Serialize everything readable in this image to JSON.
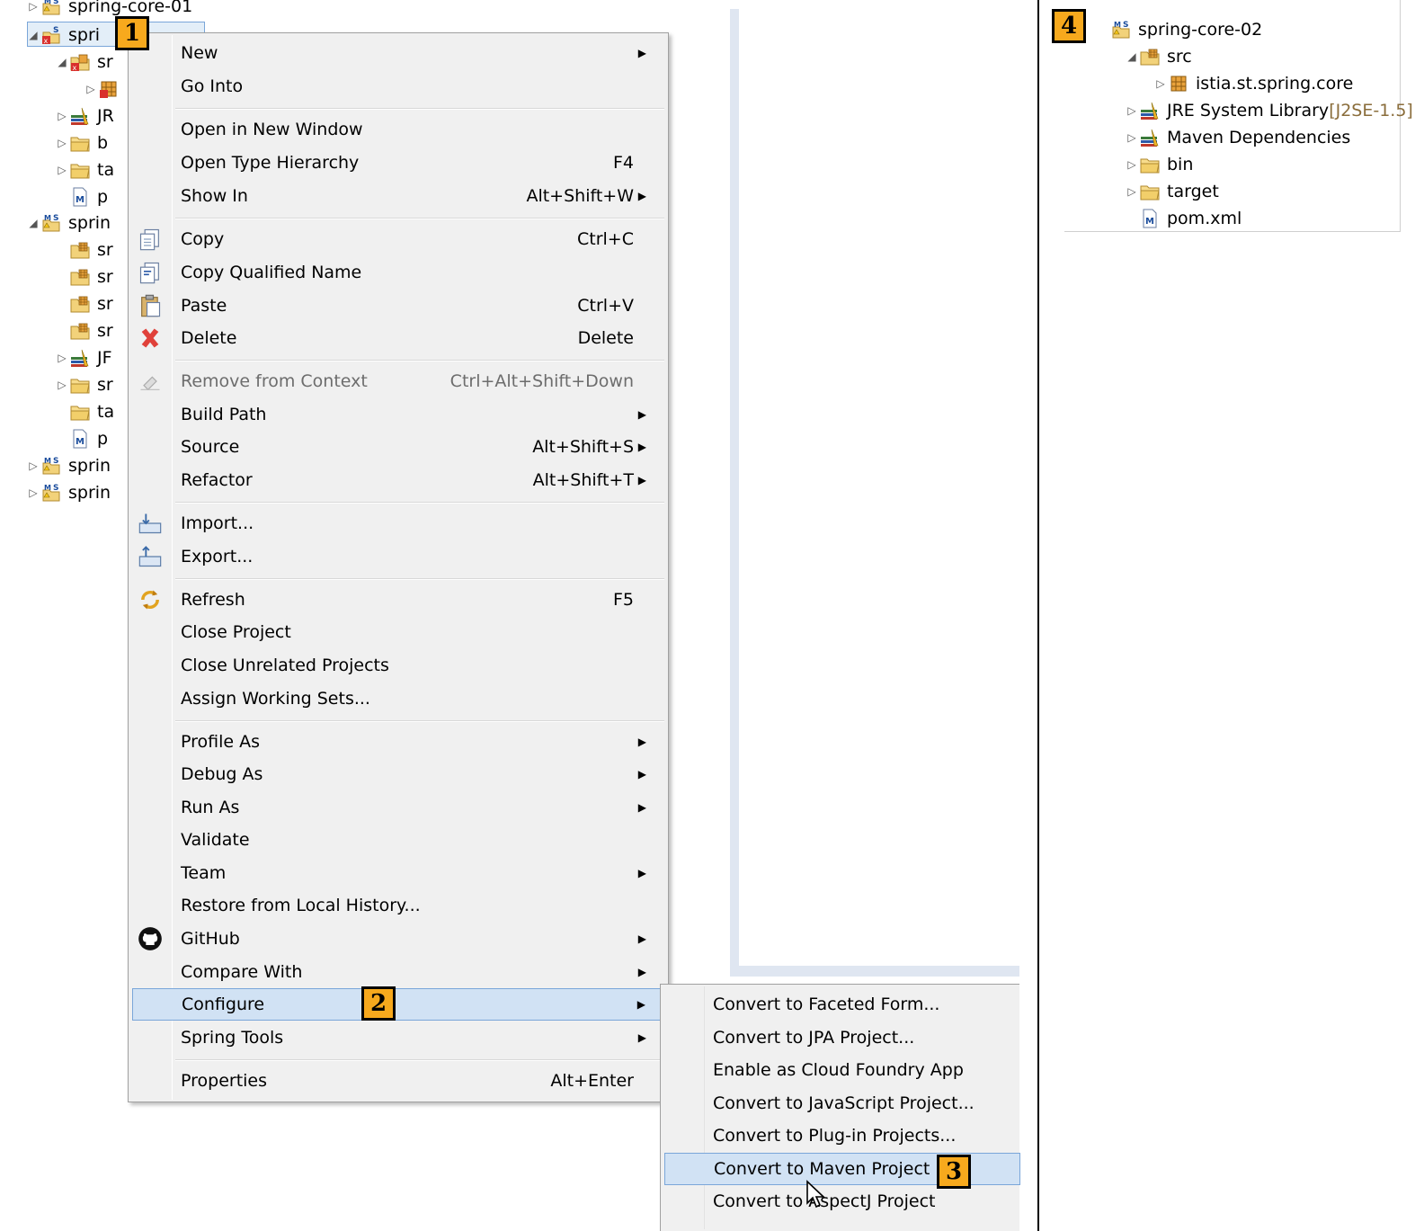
{
  "explorer": {
    "rows": [
      {
        "label": "spring-core-01",
        "indent": 0,
        "twisty": "▷",
        "icon": "maven-project-icon"
      },
      {
        "label": "spri",
        "indent": 0,
        "twisty": "◢",
        "icon": "project-error-icon"
      },
      {
        "label": "sr",
        "indent": 1,
        "twisty": "◢",
        "icon": "source-folder-error-icon"
      },
      {
        "label": "",
        "indent": 2,
        "twisty": "▷",
        "icon": "package-error-icon"
      },
      {
        "label": "JR",
        "indent": 1,
        "twisty": "▷",
        "icon": "library-icon"
      },
      {
        "label": "b",
        "indent": 1,
        "twisty": "▷",
        "icon": "folder-icon"
      },
      {
        "label": "ta",
        "indent": 1,
        "twisty": "▷",
        "icon": "folder-icon"
      },
      {
        "label": "p",
        "indent": 1,
        "twisty": "",
        "icon": "pom-file-icon"
      },
      {
        "label": "sprin",
        "indent": 0,
        "twisty": "◢",
        "icon": "maven-project-icon"
      },
      {
        "label": "sr",
        "indent": 1,
        "twisty": "",
        "icon": "source-folder-icon"
      },
      {
        "label": "sr",
        "indent": 1,
        "twisty": "",
        "icon": "source-folder-icon"
      },
      {
        "label": "sr",
        "indent": 1,
        "twisty": "",
        "icon": "source-folder-icon"
      },
      {
        "label": "sr",
        "indent": 1,
        "twisty": "",
        "icon": "source-folder-icon"
      },
      {
        "label": "JF",
        "indent": 1,
        "twisty": "▷",
        "icon": "library-icon"
      },
      {
        "label": "sr",
        "indent": 1,
        "twisty": "▷",
        "icon": "folder-icon"
      },
      {
        "label": "ta",
        "indent": 1,
        "twisty": "",
        "icon": "folder-icon"
      },
      {
        "label": "p",
        "indent": 1,
        "twisty": "",
        "icon": "pom-file-icon"
      },
      {
        "label": "sprin",
        "indent": 0,
        "twisty": "▷",
        "icon": "maven-project-icon"
      },
      {
        "label": "sprin",
        "indent": 0,
        "twisty": "▷",
        "icon": "maven-project-icon"
      }
    ]
  },
  "context_menu": {
    "items": [
      {
        "label": "New",
        "key": "",
        "arrow": true,
        "icon": ""
      },
      {
        "label": "Go Into",
        "key": "",
        "arrow": false,
        "icon": ""
      },
      {
        "label": "Open in New Window",
        "key": "",
        "arrow": false,
        "icon": ""
      },
      {
        "label": "Open Type Hierarchy",
        "key": "F4",
        "arrow": false,
        "icon": ""
      },
      {
        "label": "Show In",
        "key": "Alt+Shift+W",
        "arrow": true,
        "icon": ""
      },
      {
        "label": "Copy",
        "key": "Ctrl+C",
        "arrow": false,
        "icon": "copy-icon"
      },
      {
        "label": "Copy Qualified Name",
        "key": "",
        "arrow": false,
        "icon": "copy-qualified-icon"
      },
      {
        "label": "Paste",
        "key": "Ctrl+V",
        "arrow": false,
        "icon": "paste-icon"
      },
      {
        "label": "Delete",
        "key": "Delete",
        "arrow": false,
        "icon": "delete-icon"
      },
      {
        "label": "Remove from Context",
        "key": "Ctrl+Alt+Shift+Down",
        "arrow": false,
        "icon": "remove-context-icon",
        "disabled": true
      },
      {
        "label": "Build Path",
        "key": "",
        "arrow": true,
        "icon": ""
      },
      {
        "label": "Source",
        "key": "Alt+Shift+S",
        "arrow": true,
        "icon": ""
      },
      {
        "label": "Refactor",
        "key": "Alt+Shift+T",
        "arrow": true,
        "icon": ""
      },
      {
        "label": "Import...",
        "key": "",
        "arrow": false,
        "icon": "import-icon"
      },
      {
        "label": "Export...",
        "key": "",
        "arrow": false,
        "icon": "export-icon"
      },
      {
        "label": "Refresh",
        "key": "F5",
        "arrow": false,
        "icon": "refresh-icon"
      },
      {
        "label": "Close Project",
        "key": "",
        "arrow": false,
        "icon": ""
      },
      {
        "label": "Close Unrelated Projects",
        "key": "",
        "arrow": false,
        "icon": ""
      },
      {
        "label": "Assign Working Sets...",
        "key": "",
        "arrow": false,
        "icon": ""
      },
      {
        "label": "Profile As",
        "key": "",
        "arrow": true,
        "icon": ""
      },
      {
        "label": "Debug As",
        "key": "",
        "arrow": true,
        "icon": ""
      },
      {
        "label": "Run As",
        "key": "",
        "arrow": true,
        "icon": ""
      },
      {
        "label": "Validate",
        "key": "",
        "arrow": false,
        "icon": ""
      },
      {
        "label": "Team",
        "key": "",
        "arrow": true,
        "icon": ""
      },
      {
        "label": "Restore from Local History...",
        "key": "",
        "arrow": false,
        "icon": ""
      },
      {
        "label": "GitHub",
        "key": "",
        "arrow": true,
        "icon": "github-icon"
      },
      {
        "label": "Compare With",
        "key": "",
        "arrow": true,
        "icon": ""
      },
      {
        "label": "Configure",
        "key": "",
        "arrow": true,
        "icon": "",
        "highlighted": true
      },
      {
        "label": "Spring Tools",
        "key": "",
        "arrow": true,
        "icon": ""
      },
      {
        "label": "Properties",
        "key": "Alt+Enter",
        "arrow": false,
        "icon": ""
      }
    ]
  },
  "configure_submenu": {
    "items": [
      {
        "label": "Convert to Faceted Form..."
      },
      {
        "label": "Convert to JPA Project..."
      },
      {
        "label": "Enable as Cloud Foundry App"
      },
      {
        "label": "Convert to JavaScript Project..."
      },
      {
        "label": "Convert to Plug-in Projects..."
      },
      {
        "label": "Convert to Maven Project",
        "highlighted": true
      },
      {
        "label": "Convert to AspectJ Project"
      }
    ]
  },
  "result_tree": {
    "rows": [
      {
        "label": "spring-core-02",
        "suffix": "",
        "indent": 0,
        "twisty": "",
        "icon": "maven-project-icon"
      },
      {
        "label": "src",
        "suffix": "",
        "indent": 1,
        "twisty": "◢",
        "icon": "source-folder-icon"
      },
      {
        "label": "istia.st.spring.core",
        "suffix": "",
        "indent": 2,
        "twisty": "▷",
        "icon": "package-icon"
      },
      {
        "label": "JRE System Library ",
        "suffix": "[J2SE-1.5]",
        "indent": 1,
        "twisty": "▷",
        "icon": "library-icon"
      },
      {
        "label": "Maven Dependencies",
        "suffix": "",
        "indent": 1,
        "twisty": "▷",
        "icon": "library-icon"
      },
      {
        "label": "bin",
        "suffix": "",
        "indent": 1,
        "twisty": "▷",
        "icon": "folder-icon"
      },
      {
        "label": "target",
        "suffix": "",
        "indent": 1,
        "twisty": "▷",
        "icon": "folder-icon"
      },
      {
        "label": "pom.xml",
        "suffix": "",
        "indent": 1,
        "twisty": "",
        "icon": "pom-file-icon"
      }
    ]
  },
  "badges": [
    "1",
    "2",
    "3",
    "4"
  ],
  "colors": {
    "menu_bg": "#f0f0f0",
    "highlight": "#d1e2f4",
    "highlight_border": "#7aa6d9",
    "badge": "#f7a91d",
    "muted_suffix": "#8a6d3b"
  }
}
